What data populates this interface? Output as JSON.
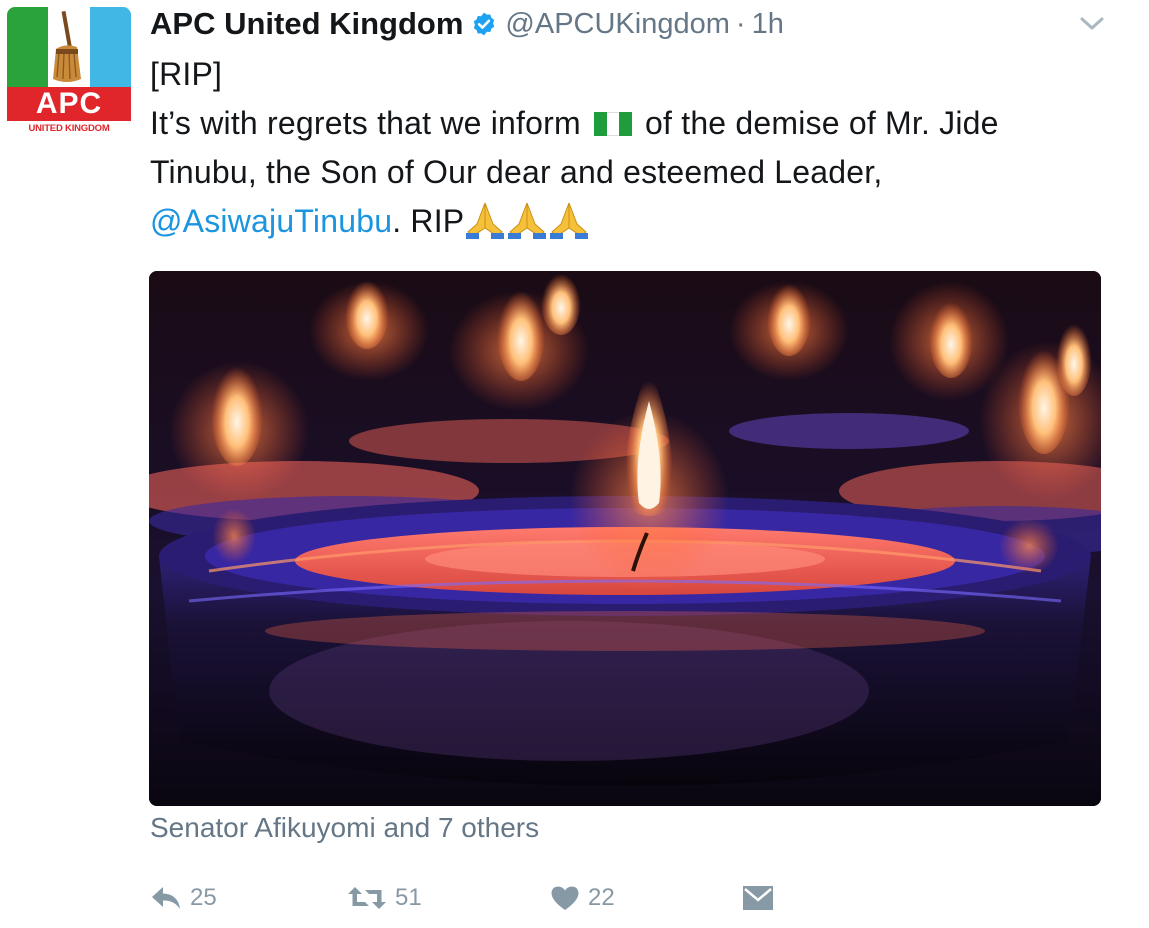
{
  "account": {
    "display_name": "APC United Kingdom",
    "handle": "@APCUKingdom",
    "separator": "·",
    "time": "1h",
    "verified": true
  },
  "avatar": {
    "logo_text": "APC",
    "logo_subtitle": "UNITED KINGDOM",
    "colors": {
      "green": "#2aa33b",
      "blue": "#41b7e6",
      "red": "#e0262b"
    }
  },
  "tweet": {
    "line1": "[RIP]",
    "line2_before": "It’s with regrets that we inform",
    "line2_after": "of the demise of Mr. Jide",
    "line3": "Tinubu, the Son of Our dear and esteemed Leader,",
    "mention": "@AsiwajuTinubu",
    "line4_after": ".  RIP",
    "emoji": {
      "flag": "nigeria-flag-emoji",
      "pray": "folded-hands-emoji"
    }
  },
  "media": {
    "subject": "candles-photo",
    "tags_text": "Senator Afikuyomi and 7 others"
  },
  "actions": {
    "reply_count": "25",
    "retweet_count": "51",
    "like_count": "22"
  },
  "colors": {
    "text": "#14171a",
    "secondary": "#657786",
    "action": "#8899a6",
    "link": "#1b95e0",
    "verified": "#1da1f2"
  }
}
